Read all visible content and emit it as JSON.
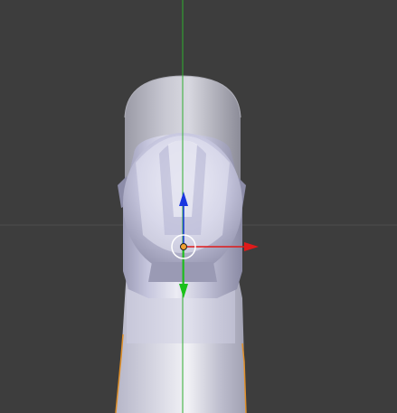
{
  "viewport": {
    "background": "#3d3d3d",
    "grid_axis_x_color": "#4a4a4a",
    "grid_axis_y_color": "#2fae2f"
  },
  "object": {
    "selected_outline_color": "#e0902a",
    "base_color": "#d4d4e4"
  },
  "gizmo": {
    "x_axis_color": "#e01a1a",
    "y_axis_color": "#1ac11a",
    "z_axis_color": "#1a36e0",
    "pivot_color": "#f0a030"
  }
}
